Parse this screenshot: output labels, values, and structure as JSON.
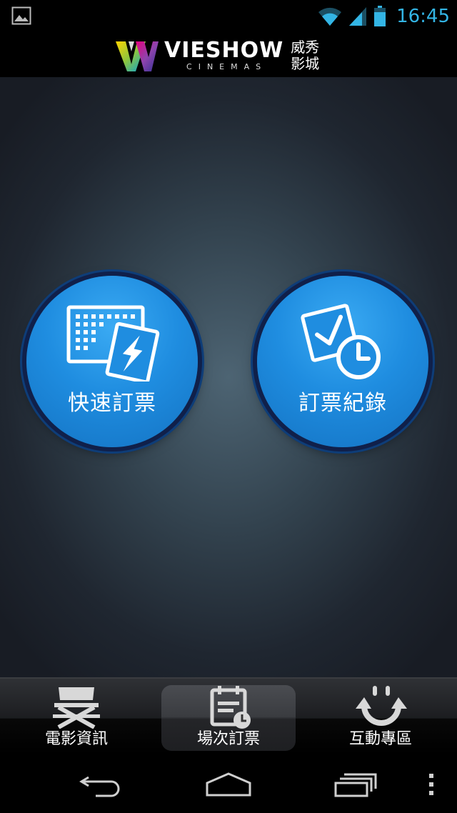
{
  "status": {
    "time": "16:45",
    "icons": [
      "gallery-icon",
      "wifi-icon",
      "signal-icon",
      "battery-icon"
    ],
    "accent_color": "#33b5e5"
  },
  "header": {
    "brand": "VIESHOW",
    "sub": "CINEMAS",
    "cn": "威秀影城"
  },
  "main": {
    "buttons": [
      {
        "label": "快速訂票",
        "icon": "quick-ticket-icon"
      },
      {
        "label": "訂票紀錄",
        "icon": "ticket-history-icon"
      }
    ],
    "button_color": "#1f8de0"
  },
  "tabs": [
    {
      "label": "電影資訊",
      "icon": "director-chair-icon"
    },
    {
      "label": "場次訂票",
      "icon": "calendar-clock-icon",
      "active": true
    },
    {
      "label": "互動專區",
      "icon": "smile-arrows-icon"
    }
  ],
  "nav": {
    "icons": [
      "back-icon",
      "home-icon",
      "recent-apps-icon",
      "menu-icon"
    ]
  }
}
